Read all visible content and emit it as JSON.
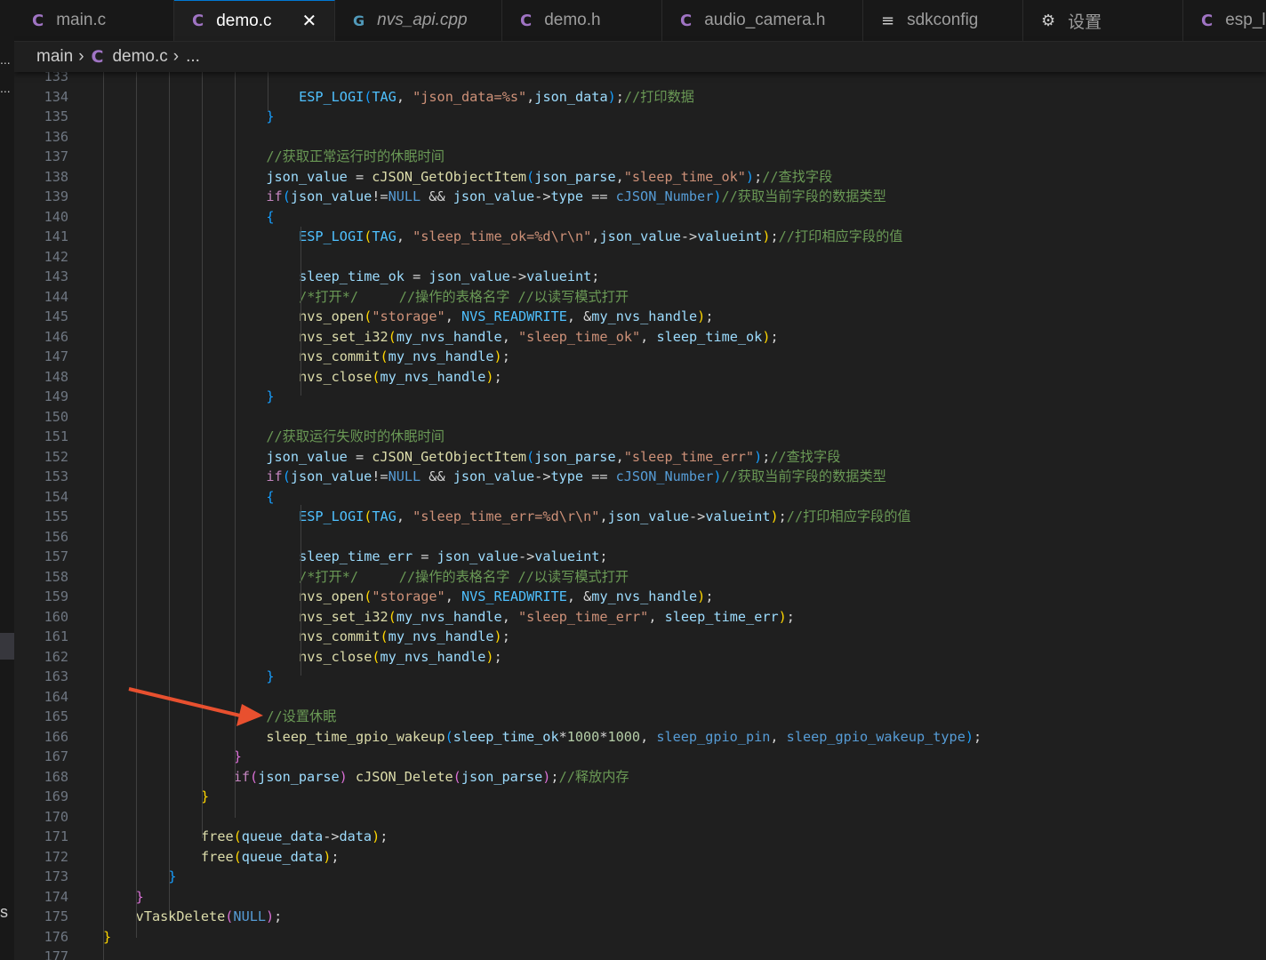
{
  "tabs": [
    {
      "icon": "C",
      "label": "main.c"
    },
    {
      "icon": "C",
      "label": "demo.c",
      "active": true,
      "close": "✕"
    },
    {
      "icon": "G",
      "label": "nvs_api.cpp"
    },
    {
      "icon": "C",
      "label": "demo.h"
    },
    {
      "icon": "C",
      "label": "audio_camera.h"
    },
    {
      "icon": "≡",
      "label": "sdkconfig"
    },
    {
      "icon": "⚙",
      "label": "设置"
    },
    {
      "icon": "C",
      "label": "esp_l"
    }
  ],
  "breadcrumb": {
    "folder": "main",
    "file_icon": "C",
    "file": "demo.c",
    "more": "..."
  },
  "left_strip": {
    "dots_top": "...",
    "dots_mid": "...",
    "bottom_text": "s"
  },
  "lines": [
    {
      "n": "133",
      "html": ""
    },
    {
      "n": "134",
      "html": "<span class='m'>ESP_LOGI</span><span class='b3'>(</span><span class='m'>TAG</span><span class='d'>, </span><span class='s'>\"json_data=%s\"</span><span class='d'>,</span><span class='v'>json_data</span><span class='b3'>)</span><span class='d'>;</span><span class='c'>//打印数据</span>"
    },
    {
      "n": "135",
      "html": "<span class='b3'>}</span>"
    },
    {
      "n": "136",
      "html": ""
    },
    {
      "n": "137",
      "html": "<span class='c'>//获取正常运行时的休眠时间</span>"
    },
    {
      "n": "138",
      "html": "<span class='v'>json_value</span><span class='d'> = </span><span class='f'>cJSON_GetObjectItem</span><span class='b3'>(</span><span class='v'>json_parse</span><span class='d'>,</span><span class='s'>\"sleep_time_ok\"</span><span class='b3'>)</span><span class='d'>;</span><span class='c'>//查找字段</span>"
    },
    {
      "n": "139",
      "html": "<span class='ctl'>if</span><span class='b3'>(</span><span class='v'>json_value</span><span class='d'>!=</span><span class='k'>NULL</span><span class='d'> &amp;&amp; </span><span class='v'>json_value</span><span class='d'>-&gt;</span><span class='v'>type</span><span class='d'> == </span><span class='k'>cJSON_Number</span><span class='b3'>)</span><span class='c'>//获取当前字段的数据类型</span>"
    },
    {
      "n": "140",
      "html": "<span class='b3'>{</span>"
    },
    {
      "n": "141",
      "html": "    <span class='m'>ESP_LOGI</span><span class='b1'>(</span><span class='m'>TAG</span><span class='d'>, </span><span class='s'>\"sleep_time_ok=%d\\r\\n\"</span><span class='d'>,</span><span class='v'>json_value</span><span class='d'>-&gt;</span><span class='v'>valueint</span><span class='b1'>)</span><span class='d'>;</span><span class='c'>//打印相应字段的值</span>"
    },
    {
      "n": "142",
      "html": ""
    },
    {
      "n": "143",
      "html": "    <span class='v'>sleep_time_ok</span><span class='d'> = </span><span class='v'>json_value</span><span class='d'>-&gt;</span><span class='v'>valueint</span><span class='d'>;</span>"
    },
    {
      "n": "144",
      "html": "    <span class='c'>/*打开*/     //操作的表格名字 //以读写模式打开</span>"
    },
    {
      "n": "145",
      "html": "    <span class='f'>nvs_open</span><span class='b1'>(</span><span class='s'>\"storage\"</span><span class='d'>, </span><span class='m'>NVS_READWRITE</span><span class='d'>, &amp;</span><span class='v'>my_nvs_handle</span><span class='b1'>)</span><span class='d'>;</span>"
    },
    {
      "n": "146",
      "html": "    <span class='f'>nvs_set_i32</span><span class='b1'>(</span><span class='v'>my_nvs_handle</span><span class='d'>, </span><span class='s'>\"sleep_time_ok\"</span><span class='d'>, </span><span class='v'>sleep_time_ok</span><span class='b1'>)</span><span class='d'>;</span>"
    },
    {
      "n": "147",
      "html": "    <span class='f'>nvs_commit</span><span class='b1'>(</span><span class='v'>my_nvs_handle</span><span class='b1'>)</span><span class='d'>;</span>"
    },
    {
      "n": "148",
      "html": "    <span class='f'>nvs_close</span><span class='b1'>(</span><span class='v'>my_nvs_handle</span><span class='b1'>)</span><span class='d'>;</span>"
    },
    {
      "n": "149",
      "html": "<span class='b3'>}</span>"
    },
    {
      "n": "150",
      "html": ""
    },
    {
      "n": "151",
      "html": "<span class='c'>//获取运行失败时的休眠时间</span>"
    },
    {
      "n": "152",
      "html": "<span class='v'>json_value</span><span class='d'> = </span><span class='f'>cJSON_GetObjectItem</span><span class='b3'>(</span><span class='v'>json_parse</span><span class='d'>,</span><span class='s'>\"sleep_time_err\"</span><span class='b3'>)</span><span class='d'>;</span><span class='c'>//查找字段</span>"
    },
    {
      "n": "153",
      "html": "<span class='ctl'>if</span><span class='b3'>(</span><span class='v'>json_value</span><span class='d'>!=</span><span class='k'>NULL</span><span class='d'> &amp;&amp; </span><span class='v'>json_value</span><span class='d'>-&gt;</span><span class='v'>type</span><span class='d'> == </span><span class='k'>cJSON_Number</span><span class='b3'>)</span><span class='c'>//获取当前字段的数据类型</span>"
    },
    {
      "n": "154",
      "html": "<span class='b3'>{</span>"
    },
    {
      "n": "155",
      "html": "    <span class='m'>ESP_LOGI</span><span class='b1'>(</span><span class='m'>TAG</span><span class='d'>, </span><span class='s'>\"sleep_time_err=%d\\r\\n\"</span><span class='d'>,</span><span class='v'>json_value</span><span class='d'>-&gt;</span><span class='v'>valueint</span><span class='b1'>)</span><span class='d'>;</span><span class='c'>//打印相应字段的值</span>"
    },
    {
      "n": "156",
      "html": ""
    },
    {
      "n": "157",
      "html": "    <span class='v'>sleep_time_err</span><span class='d'> = </span><span class='v'>json_value</span><span class='d'>-&gt;</span><span class='v'>valueint</span><span class='d'>;</span>"
    },
    {
      "n": "158",
      "html": "    <span class='c'>/*打开*/     //操作的表格名字 //以读写模式打开</span>"
    },
    {
      "n": "159",
      "html": "    <span class='f'>nvs_open</span><span class='b1'>(</span><span class='s'>\"storage\"</span><span class='d'>, </span><span class='m'>NVS_READWRITE</span><span class='d'>, &amp;</span><span class='v'>my_nvs_handle</span><span class='b1'>)</span><span class='d'>;</span>"
    },
    {
      "n": "160",
      "html": "    <span class='f'>nvs_set_i32</span><span class='b1'>(</span><span class='v'>my_nvs_handle</span><span class='d'>, </span><span class='s'>\"sleep_time_err\"</span><span class='d'>, </span><span class='v'>sleep_time_err</span><span class='b1'>)</span><span class='d'>;</span>"
    },
    {
      "n": "161",
      "html": "    <span class='f'>nvs_commit</span><span class='b1'>(</span><span class='v'>my_nvs_handle</span><span class='b1'>)</span><span class='d'>;</span>"
    },
    {
      "n": "162",
      "html": "    <span class='f'>nvs_close</span><span class='b1'>(</span><span class='v'>my_nvs_handle</span><span class='b1'>)</span><span class='d'>;</span>"
    },
    {
      "n": "163",
      "html": "<span class='b3'>}</span>"
    },
    {
      "n": "164",
      "html": ""
    },
    {
      "n": "165",
      "html": "<span class='c'>//设置休眠</span>"
    },
    {
      "n": "166",
      "html": "<span class='f'>sleep_time_gpio_wakeup</span><span class='b3'>(</span><span class='v'>sleep_time_ok</span><span class='d'>*</span><span class='n'>1000</span><span class='d'>*</span><span class='n'>1000</span><span class='d'>, </span><span class='k'>sleep_gpio_pin</span><span class='d'>, </span><span class='k'>sleep_gpio_wakeup_type</span><span class='b3'>)</span><span class='d'>;</span>"
    },
    {
      "n": "167",
      "html": "<span class='b2'>}</span>"
    },
    {
      "n": "168",
      "html": "<span class='ctl'>if</span><span class='b2'>(</span><span class='v'>json_parse</span><span class='b2'>)</span><span class='d'> </span><span class='f'>cJSON_Delete</span><span class='b2'>(</span><span class='v'>json_parse</span><span class='b2'>)</span><span class='d'>;</span><span class='c'>//释放内存</span>"
    },
    {
      "n": "169",
      "html": "<span class='b1'>}</span>"
    },
    {
      "n": "170",
      "html": ""
    },
    {
      "n": "171",
      "html": "<span class='f'>free</span><span class='b1'>(</span><span class='v'>queue_data</span><span class='d'>-&gt;</span><span class='v'>data</span><span class='b1'>)</span><span class='d'>;</span>"
    },
    {
      "n": "172",
      "html": "<span class='f'>free</span><span class='b1'>(</span><span class='v'>queue_data</span><span class='b1'>)</span><span class='d'>;</span>"
    },
    {
      "n": "173",
      "html": "<span class='b3'>}</span>"
    },
    {
      "n": "174",
      "html": "<span class='b2'>}</span>"
    },
    {
      "n": "175",
      "html": "<span class='f'>vTaskDelete</span><span class='b2'>(</span><span class='k'>NULL</span><span class='b2'>)</span><span class='d'>;</span>"
    },
    {
      "n": "176",
      "html": "<span class='b1'>}</span>"
    },
    {
      "n": "177",
      "html": ""
    }
  ],
  "annotation": {
    "color": "#e8502f"
  }
}
